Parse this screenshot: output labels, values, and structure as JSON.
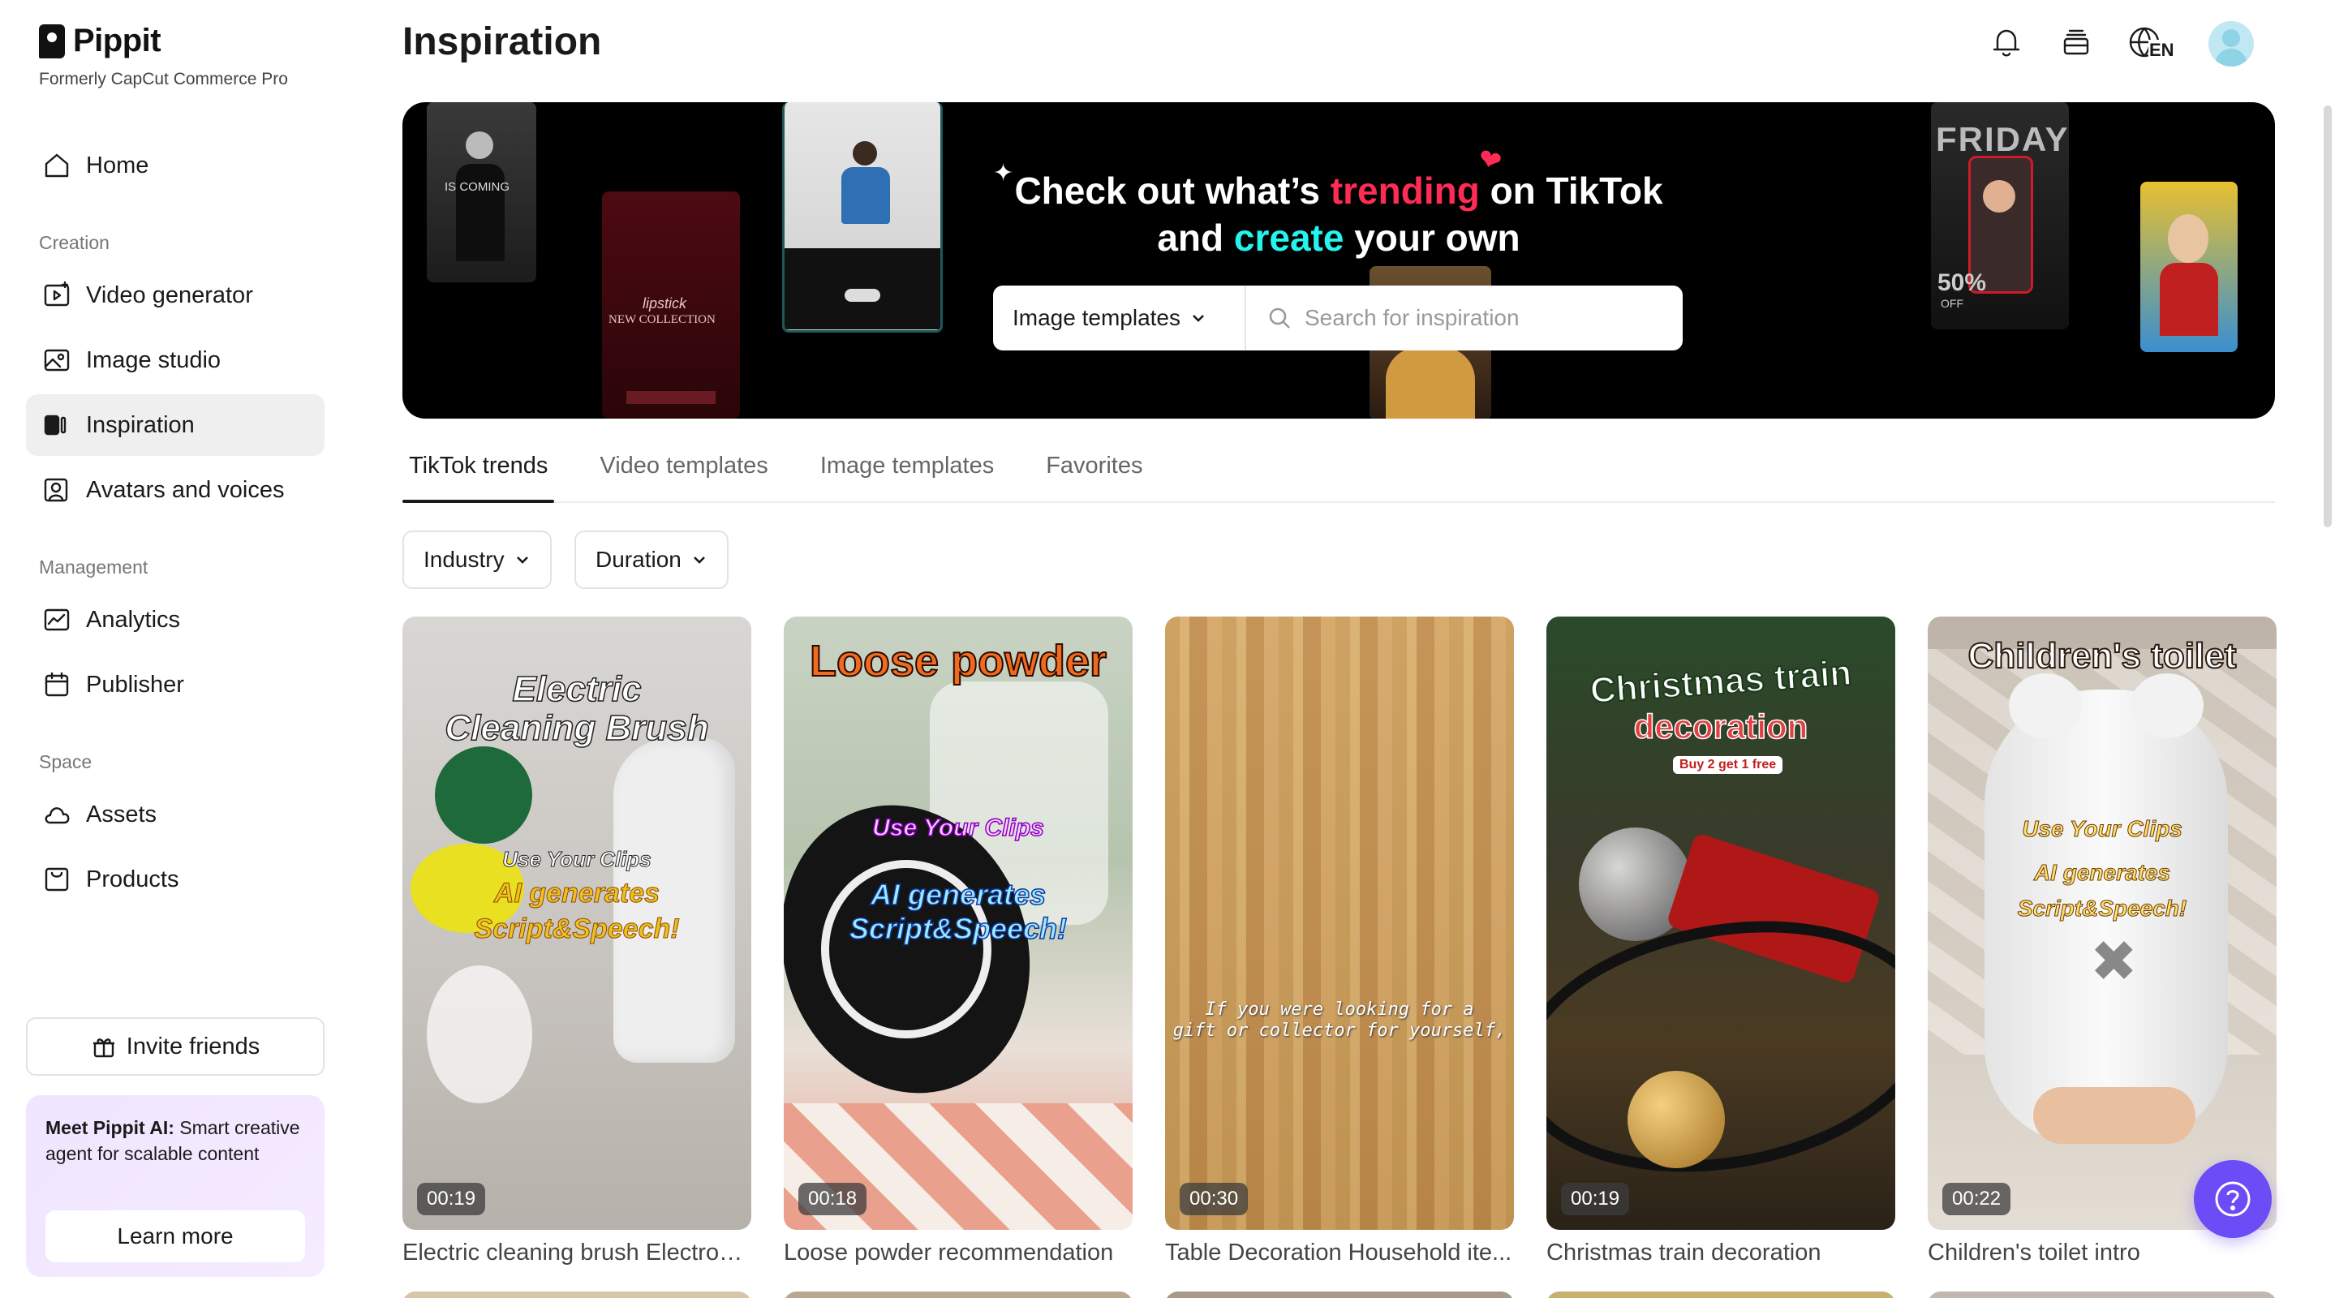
{
  "brand": {
    "name": "Pippit",
    "subtitle": "Formerly CapCut Commerce Pro"
  },
  "sidebar": {
    "home": "Home",
    "sections": [
      {
        "label": "Creation",
        "items": [
          "Video generator",
          "Image studio",
          "Inspiration",
          "Avatars and voices"
        ]
      },
      {
        "label": "Management",
        "items": [
          "Analytics",
          "Publisher"
        ]
      },
      {
        "label": "Space",
        "items": [
          "Assets",
          "Products"
        ]
      }
    ],
    "active_item": "Inspiration",
    "invite_label": "Invite friends",
    "promo": {
      "bold": "Meet Pippit AI:",
      "text": " Smart creative agent for scalable content",
      "button": "Learn more"
    }
  },
  "header": {
    "title": "Inspiration",
    "lang": "EN"
  },
  "banner": {
    "line1_a": "Check out what’s ",
    "line1_highlight": "trending",
    "line1_b": " on TikTok",
    "line2_a": "and ",
    "line2_highlight": "create",
    "line2_b": " your own",
    "search_type": "Image templates",
    "search_placeholder": "Search for inspiration",
    "thumb_texts": {
      "coming": "IS COMING",
      "lipstick": "lipstick",
      "collection": "NEW COLLECTION",
      "friday": "FRIDAY",
      "pct": "50%",
      "off": "OFF"
    }
  },
  "tabs": [
    "TikTok trends",
    "Video templates",
    "Image templates",
    "Favorites"
  ],
  "active_tab": "TikTok trends",
  "filters": [
    "Industry",
    "Duration"
  ],
  "cards": [
    {
      "title": "Electric cleaning brush Electronic...",
      "duration": "00:19",
      "overlay": [
        "Electric",
        "Cleaning Brush"
      ],
      "sub1": "Use Your Clips",
      "sub2": "AI generates",
      "sub3": "Script&Speech!"
    },
    {
      "title": "Loose powder recommendation",
      "duration": "00:18",
      "overlay": [
        "Loose powder"
      ],
      "sub1": "Use Your Clips",
      "sub2": "AI generates",
      "sub3": "Script&Speech!"
    },
    {
      "title": "Table Decoration Household ite...",
      "duration": "00:30",
      "overlay": [
        "If you were looking for a",
        "gift or collector for yourself,"
      ]
    },
    {
      "title": "Christmas train decoration",
      "duration": "00:19",
      "overlay": [
        "Christmas train",
        "decoration"
      ],
      "sub1": "Buy 2 get 1 free"
    },
    {
      "title": "Children's toilet intro",
      "duration": "00:22",
      "overlay": [
        "Children's toilet"
      ],
      "sub1": "Use Your Clips",
      "sub2": "AI generates",
      "sub3": "Script&Speech!"
    }
  ],
  "colors": {
    "tiktok_pink": "#fe2c55",
    "tiktok_cyan": "#25f4ee",
    "help_purple": "#6b4cf6",
    "active_nav_bg": "#efefef"
  }
}
